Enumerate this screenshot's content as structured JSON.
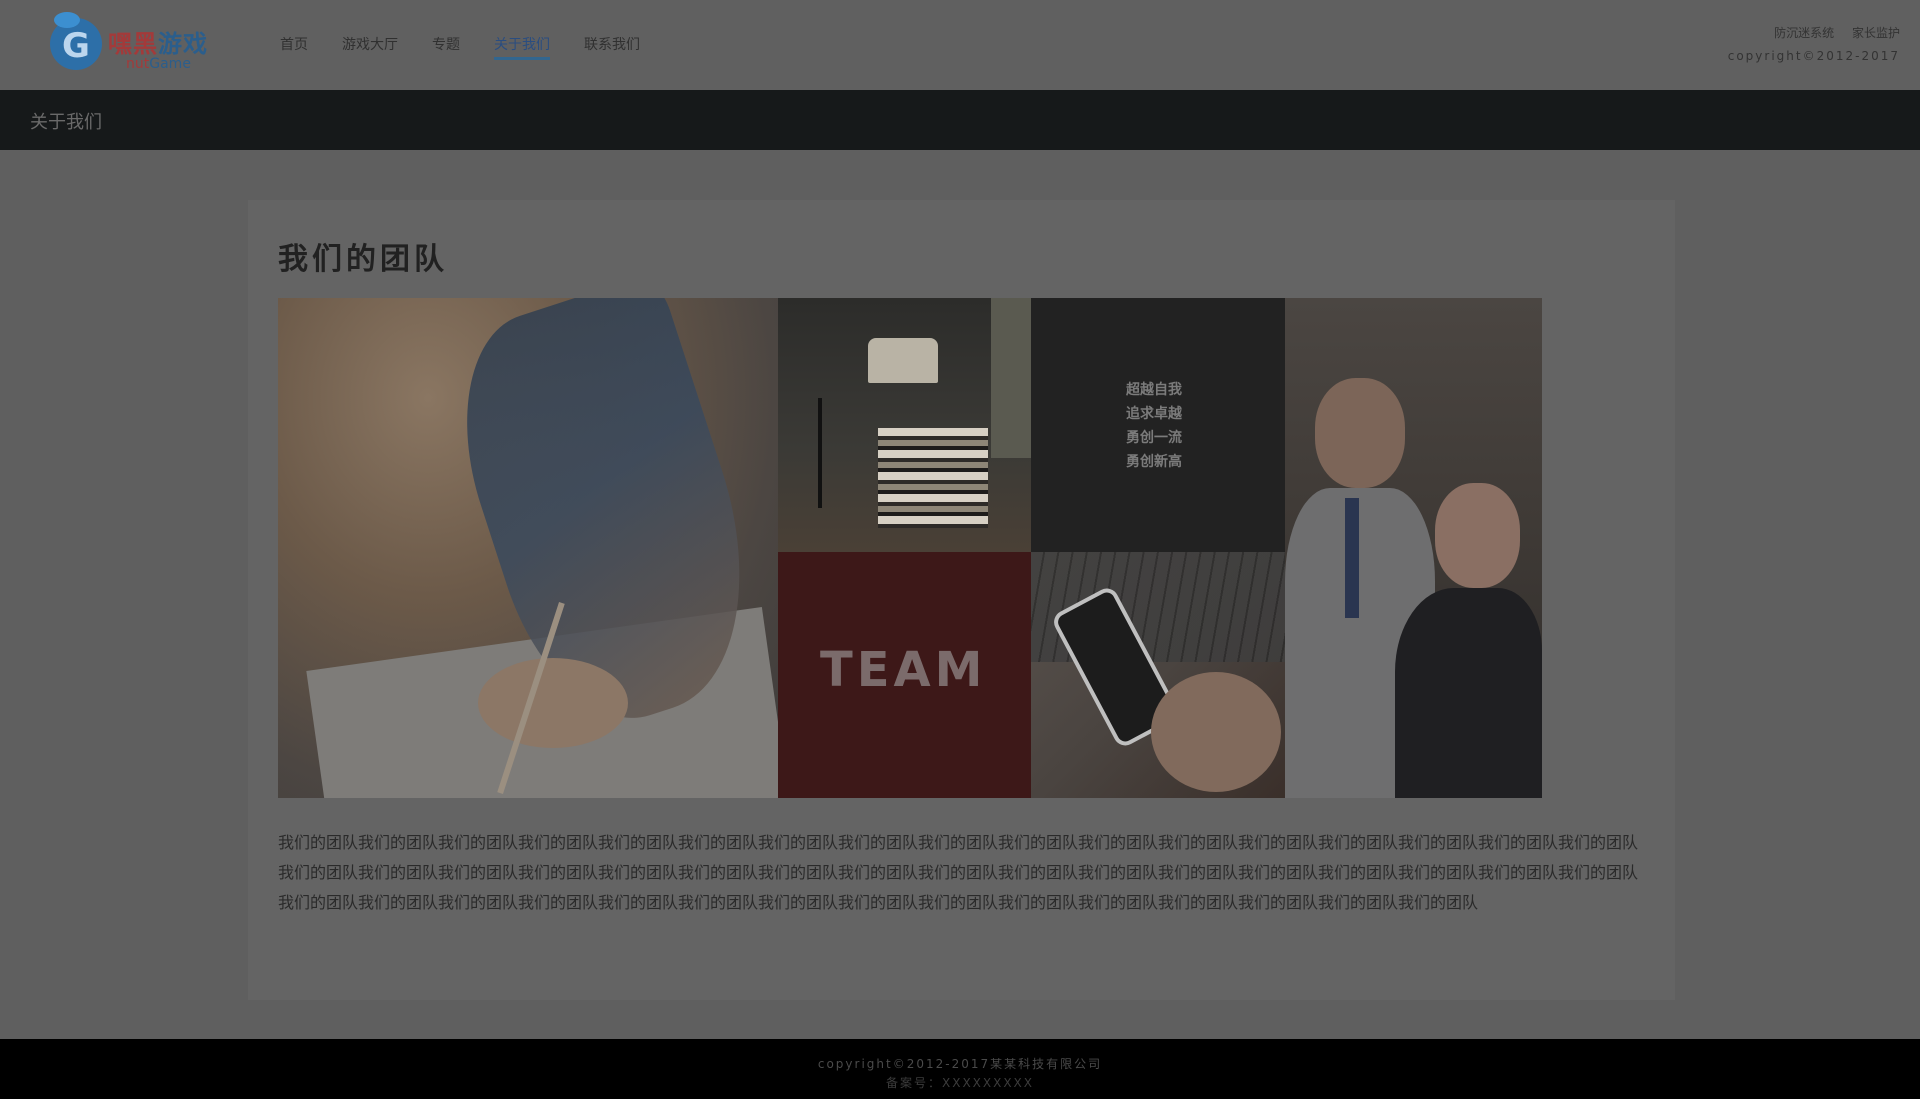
{
  "logo": {
    "cn_a": "嘿黑",
    "cn_b": "游戏",
    "en_a": "nut",
    "en_b": "Game"
  },
  "nav": {
    "items": [
      "首页",
      "游戏大厅",
      "专题",
      "关于我们",
      "联系我们"
    ],
    "active": "关于我们"
  },
  "top_right": {
    "links": [
      "防沉迷系统",
      "家长监护"
    ],
    "copyright": "copyright©2012-2017"
  },
  "breadcrumb": "关于我们",
  "section_title": "我们的团队",
  "motto": [
    "超越自我",
    "追求卓越",
    "勇创一流",
    "勇创新高"
  ],
  "team_word": "TEAM",
  "description": "我们的团队我们的团队我们的团队我们的团队我们的团队我们的团队我们的团队我们的团队我们的团队我们的团队我们的团队我们的团队我们的团队我们的团队我们的团队我们的团队我们的团队我们的团队我们的团队我们的团队我们的团队我们的团队我们的团队我们的团队我们的团队我们的团队我们的团队我们的团队我们的团队我们的团队我们的团队我们的团队我们的团队我们的团队我们的团队我们的团队我们的团队我们的团队我们的团队我们的团队我们的团队我们的团队我们的团队我们的团队我们的团队我们的团队我们的团队我们的团队我们的团队",
  "footer": {
    "copyright": "copyright©2012-2017某某科技有限公司",
    "icp": "备案号：XXXXXXXXX"
  },
  "colors": {
    "active_nav": "#328BFE",
    "breadcrumb_bar": "#25292B",
    "team_tile": "#D33E38",
    "motto_tile": "#3D3938"
  }
}
